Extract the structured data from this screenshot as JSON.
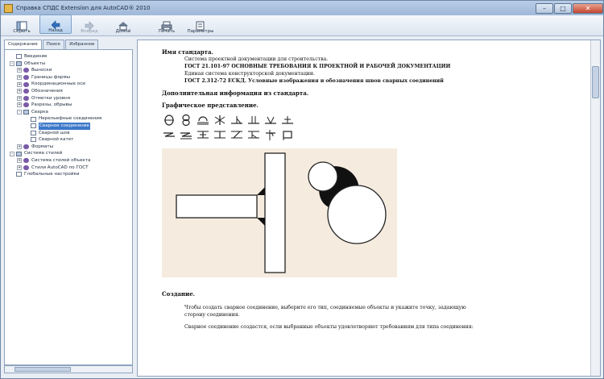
{
  "window": {
    "title": "Справка СПДС Extension для AutoCAD® 2010"
  },
  "toolbar": [
    {
      "label": "Скрыть",
      "icon": "hide-pane-icon",
      "state": "normal"
    },
    {
      "label": "Назад",
      "icon": "back-arrow-icon",
      "state": "active"
    },
    {
      "label": "Вперед",
      "icon": "forward-arrow-icon",
      "state": "disabled"
    },
    {
      "label": "Домой",
      "icon": "home-icon",
      "state": "normal"
    },
    {
      "label": "Печать",
      "icon": "print-icon",
      "state": "normal"
    },
    {
      "label": "Параметры",
      "icon": "options-icon",
      "state": "normal"
    }
  ],
  "nav_tabs": [
    "Содержание",
    "Поиск",
    "Избранное"
  ],
  "tree": [
    {
      "level": 0,
      "exp": "",
      "icon": "page",
      "label": "Введение"
    },
    {
      "level": 0,
      "exp": "-",
      "icon": "folder",
      "label": "Объекты"
    },
    {
      "level": 1,
      "exp": "+",
      "icon": "book",
      "label": "Выноски"
    },
    {
      "level": 1,
      "exp": "+",
      "icon": "book",
      "label": "Границы формы"
    },
    {
      "level": 1,
      "exp": "+",
      "icon": "book",
      "label": "Координационные оси"
    },
    {
      "level": 1,
      "exp": "+",
      "icon": "book",
      "label": "Обозначения"
    },
    {
      "level": 1,
      "exp": "+",
      "icon": "book",
      "label": "Отметки уровня"
    },
    {
      "level": 1,
      "exp": "+",
      "icon": "book",
      "label": "Разрезы, обрывы"
    },
    {
      "level": 1,
      "exp": "-",
      "icon": "folder",
      "label": "Сварка"
    },
    {
      "level": 2,
      "exp": "",
      "icon": "page",
      "label": "Нерельефные соединения"
    },
    {
      "level": 2,
      "exp": "",
      "icon": "page",
      "label": "Сварное соединение",
      "selected": true
    },
    {
      "level": 2,
      "exp": "",
      "icon": "page",
      "label": "Сварной шов"
    },
    {
      "level": 2,
      "exp": "",
      "icon": "page",
      "label": "Сварной катет"
    },
    {
      "level": 1,
      "exp": "+",
      "icon": "book",
      "label": "Форматы"
    },
    {
      "level": 0,
      "exp": "-",
      "icon": "folder",
      "label": "Система стилей"
    },
    {
      "level": 1,
      "exp": "+",
      "icon": "book",
      "label": "Система стилей объекта"
    },
    {
      "level": 1,
      "exp": "+",
      "icon": "book",
      "label": "Стили AutoCAD по ГОСТ"
    },
    {
      "level": 0,
      "exp": "",
      "icon": "page",
      "label": "Глобальные настройки"
    }
  ],
  "content": {
    "h_standard": "Имя стандарта.",
    "std_lines": [
      "Система проектной документации для строительства.",
      "ГОСТ 21.101-97 ОСНОВНЫЕ ТРЕБОВАНИЯ К ПРОЕКТНОЙ И РАБОЧЕЙ ДОКУМЕНТАЦИИ",
      "Единая система конструкторской документации.",
      "ГОСТ 2.312-72 ЕСКД. Условные изображения и обозначения швов сварных соединений"
    ],
    "h_additional": "Дополнительная информация из стандарта.",
    "h_graphic": "Графическое представление.",
    "h_create": "Создание.",
    "create_text1": "Чтобы создать сварное соединение, выберите его тип, соединяемые объекты и укажите точку, задающую",
    "create_text2": "сторону соединения.",
    "create_text3": "Сварное соединение создастся, если выбранные объекты удовлетворяют требованиям для типа соединения:"
  },
  "colors": {
    "figure_bg": "#f5ecdf",
    "selection": "#3d78c9"
  }
}
